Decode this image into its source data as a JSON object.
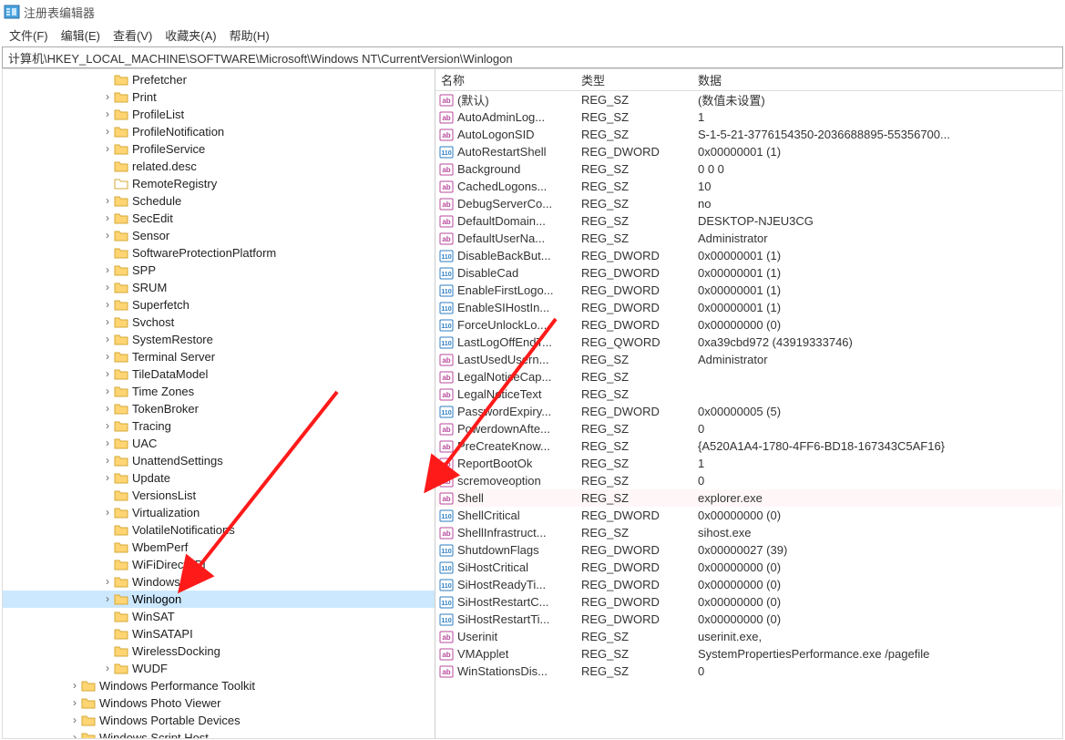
{
  "window": {
    "title": "注册表编辑器"
  },
  "menu": {
    "file": "文件(F)",
    "edit": "编辑(E)",
    "view": "查看(V)",
    "favorites": "收藏夹(A)",
    "help": "帮助(H)"
  },
  "address": "计算机\\HKEY_LOCAL_MACHINE\\SOFTWARE\\Microsoft\\Windows NT\\CurrentVersion\\Winlogon",
  "tree": [
    {
      "label": "Prefetcher",
      "indent": 6,
      "exp": "",
      "folder": true
    },
    {
      "label": "Print",
      "indent": 6,
      "exp": ">",
      "folder": true
    },
    {
      "label": "ProfileList",
      "indent": 6,
      "exp": ">",
      "folder": true
    },
    {
      "label": "ProfileNotification",
      "indent": 6,
      "exp": ">",
      "folder": true
    },
    {
      "label": "ProfileService",
      "indent": 6,
      "exp": ">",
      "folder": true
    },
    {
      "label": "related.desc",
      "indent": 6,
      "exp": "",
      "folder": true
    },
    {
      "label": "RemoteRegistry",
      "indent": 6,
      "exp": "",
      "folder": false
    },
    {
      "label": "Schedule",
      "indent": 6,
      "exp": ">",
      "folder": true
    },
    {
      "label": "SecEdit",
      "indent": 6,
      "exp": ">",
      "folder": true
    },
    {
      "label": "Sensor",
      "indent": 6,
      "exp": ">",
      "folder": true
    },
    {
      "label": "SoftwareProtectionPlatform",
      "indent": 6,
      "exp": "",
      "folder": true
    },
    {
      "label": "SPP",
      "indent": 6,
      "exp": ">",
      "folder": true
    },
    {
      "label": "SRUM",
      "indent": 6,
      "exp": ">",
      "folder": true
    },
    {
      "label": "Superfetch",
      "indent": 6,
      "exp": ">",
      "folder": true
    },
    {
      "label": "Svchost",
      "indent": 6,
      "exp": ">",
      "folder": true
    },
    {
      "label": "SystemRestore",
      "indent": 6,
      "exp": ">",
      "folder": true
    },
    {
      "label": "Terminal Server",
      "indent": 6,
      "exp": ">",
      "folder": true
    },
    {
      "label": "TileDataModel",
      "indent": 6,
      "exp": ">",
      "folder": true
    },
    {
      "label": "Time Zones",
      "indent": 6,
      "exp": ">",
      "folder": true
    },
    {
      "label": "TokenBroker",
      "indent": 6,
      "exp": ">",
      "folder": true
    },
    {
      "label": "Tracing",
      "indent": 6,
      "exp": ">",
      "folder": true
    },
    {
      "label": "UAC",
      "indent": 6,
      "exp": ">",
      "folder": true
    },
    {
      "label": "UnattendSettings",
      "indent": 6,
      "exp": ">",
      "folder": true
    },
    {
      "label": "Update",
      "indent": 6,
      "exp": ">",
      "folder": true
    },
    {
      "label": "VersionsList",
      "indent": 6,
      "exp": "",
      "folder": true
    },
    {
      "label": "Virtualization",
      "indent": 6,
      "exp": ">",
      "folder": true
    },
    {
      "label": "VolatileNotifications",
      "indent": 6,
      "exp": "",
      "folder": true
    },
    {
      "label": "WbemPerf",
      "indent": 6,
      "exp": "",
      "folder": true
    },
    {
      "label": "WiFiDirectAPI",
      "indent": 6,
      "exp": "",
      "folder": true
    },
    {
      "label": "Windows",
      "indent": 6,
      "exp": ">",
      "folder": true
    },
    {
      "label": "Winlogon",
      "indent": 6,
      "exp": ">",
      "folder": true,
      "selected": true
    },
    {
      "label": "WinSAT",
      "indent": 6,
      "exp": "",
      "folder": true
    },
    {
      "label": "WinSATAPI",
      "indent": 6,
      "exp": "",
      "folder": true
    },
    {
      "label": "WirelessDocking",
      "indent": 6,
      "exp": "",
      "folder": true
    },
    {
      "label": "WUDF",
      "indent": 6,
      "exp": ">",
      "folder": true
    },
    {
      "label": "Windows Performance Toolkit",
      "indent": 4,
      "exp": ">",
      "folder": true
    },
    {
      "label": "Windows Photo Viewer",
      "indent": 4,
      "exp": ">",
      "folder": true
    },
    {
      "label": "Windows Portable Devices",
      "indent": 4,
      "exp": ">",
      "folder": true
    },
    {
      "label": "Windows Script Host",
      "indent": 4,
      "exp": ">",
      "folder": true
    }
  ],
  "columns": {
    "name": "名称",
    "type": "类型",
    "data": "数据"
  },
  "values": [
    {
      "icon": "sz",
      "name": "(默认)",
      "type": "REG_SZ",
      "data": "(数值未设置)"
    },
    {
      "icon": "sz",
      "name": "AutoAdminLog...",
      "type": "REG_SZ",
      "data": "1"
    },
    {
      "icon": "sz",
      "name": "AutoLogonSID",
      "type": "REG_SZ",
      "data": "S-1-5-21-3776154350-2036688895-55356700..."
    },
    {
      "icon": "dw",
      "name": "AutoRestartShell",
      "type": "REG_DWORD",
      "data": "0x00000001 (1)"
    },
    {
      "icon": "sz",
      "name": "Background",
      "type": "REG_SZ",
      "data": "0 0 0"
    },
    {
      "icon": "sz",
      "name": "CachedLogons...",
      "type": "REG_SZ",
      "data": "10"
    },
    {
      "icon": "sz",
      "name": "DebugServerCo...",
      "type": "REG_SZ",
      "data": "no"
    },
    {
      "icon": "sz",
      "name": "DefaultDomain...",
      "type": "REG_SZ",
      "data": "DESKTOP-NJEU3CG"
    },
    {
      "icon": "sz",
      "name": "DefaultUserNa...",
      "type": "REG_SZ",
      "data": "Administrator"
    },
    {
      "icon": "dw",
      "name": "DisableBackBut...",
      "type": "REG_DWORD",
      "data": "0x00000001 (1)"
    },
    {
      "icon": "dw",
      "name": "DisableCad",
      "type": "REG_DWORD",
      "data": "0x00000001 (1)"
    },
    {
      "icon": "dw",
      "name": "EnableFirstLogo...",
      "type": "REG_DWORD",
      "data": "0x00000001 (1)"
    },
    {
      "icon": "dw",
      "name": "EnableSIHostIn...",
      "type": "REG_DWORD",
      "data": "0x00000001 (1)"
    },
    {
      "icon": "dw",
      "name": "ForceUnlockLo...",
      "type": "REG_DWORD",
      "data": "0x00000000 (0)"
    },
    {
      "icon": "dw",
      "name": "LastLogOffEndT...",
      "type": "REG_QWORD",
      "data": "0xa39cbd972 (43919333746)"
    },
    {
      "icon": "sz",
      "name": "LastUsedUsern...",
      "type": "REG_SZ",
      "data": "Administrator"
    },
    {
      "icon": "sz",
      "name": "LegalNoticeCap...",
      "type": "REG_SZ",
      "data": ""
    },
    {
      "icon": "sz",
      "name": "LegalNoticeText",
      "type": "REG_SZ",
      "data": ""
    },
    {
      "icon": "dw",
      "name": "PasswordExpiry...",
      "type": "REG_DWORD",
      "data": "0x00000005 (5)"
    },
    {
      "icon": "sz",
      "name": "PowerdownAfte...",
      "type": "REG_SZ",
      "data": "0"
    },
    {
      "icon": "sz",
      "name": "PreCreateKnow...",
      "type": "REG_SZ",
      "data": "{A520A1A4-1780-4FF6-BD18-167343C5AF16}"
    },
    {
      "icon": "sz",
      "name": "ReportBootOk",
      "type": "REG_SZ",
      "data": "1"
    },
    {
      "icon": "sz",
      "name": "scremoveoption",
      "type": "REG_SZ",
      "data": "0"
    },
    {
      "icon": "sz",
      "name": "Shell",
      "type": "REG_SZ",
      "data": "explorer.exe",
      "highlight": true
    },
    {
      "icon": "dw",
      "name": "ShellCritical",
      "type": "REG_DWORD",
      "data": "0x00000000 (0)"
    },
    {
      "icon": "sz",
      "name": "ShellInfrastruct...",
      "type": "REG_SZ",
      "data": "sihost.exe"
    },
    {
      "icon": "dw",
      "name": "ShutdownFlags",
      "type": "REG_DWORD",
      "data": "0x00000027 (39)"
    },
    {
      "icon": "dw",
      "name": "SiHostCritical",
      "type": "REG_DWORD",
      "data": "0x00000000 (0)"
    },
    {
      "icon": "dw",
      "name": "SiHostReadyTi...",
      "type": "REG_DWORD",
      "data": "0x00000000 (0)"
    },
    {
      "icon": "dw",
      "name": "SiHostRestartC...",
      "type": "REG_DWORD",
      "data": "0x00000000 (0)"
    },
    {
      "icon": "dw",
      "name": "SiHostRestartTi...",
      "type": "REG_DWORD",
      "data": "0x00000000 (0)"
    },
    {
      "icon": "sz",
      "name": "Userinit",
      "type": "REG_SZ",
      "data": "userinit.exe,"
    },
    {
      "icon": "sz",
      "name": "VMApplet",
      "type": "REG_SZ",
      "data": "SystemPropertiesPerformance.exe /pagefile"
    },
    {
      "icon": "sz",
      "name": "WinStationsDis...",
      "type": "REG_SZ",
      "data": "0"
    }
  ],
  "icons": {
    "app": "regedit-icon",
    "folder": "folder-icon",
    "sz": "string-value-icon",
    "dw": "dword-value-icon"
  }
}
